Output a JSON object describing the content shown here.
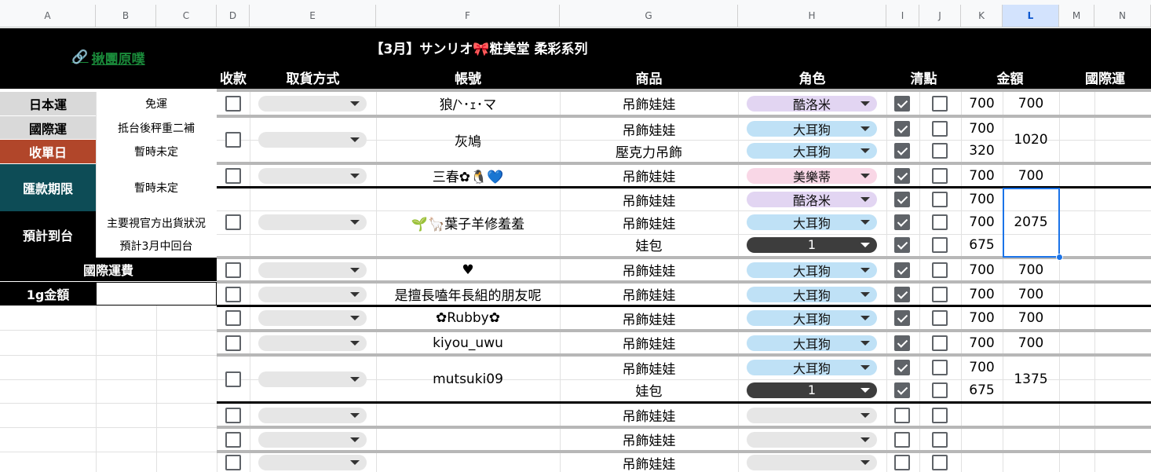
{
  "column_headers": [
    "A",
    "B",
    "C",
    "D",
    "E",
    "F",
    "G",
    "H",
    "I",
    "J",
    "K",
    "L",
    "M",
    "N"
  ],
  "selected_column": "L",
  "title": "【3月】サンリオ🎀粧美堂 柔彩系列",
  "link_text": "揪團原噗",
  "headers": {
    "col_payment": "收款",
    "col_pickup": "取貨方式",
    "col_account": "帳號",
    "col_product": "商品",
    "col_character": "角色",
    "col_check": "清點",
    "col_amount": "金額",
    "col_intl": "國際運"
  },
  "sidebar": {
    "jp_ship_label": "日本運",
    "jp_ship_value": "免運",
    "intl_ship_label": "國際運",
    "intl_ship_value": "抵台後秤重二補",
    "close_date_label": "收單日",
    "close_date_value": "暫時未定",
    "deadline_label": "匯款期限",
    "deadline_value": "暫時未定",
    "arrival_label": "預計到台",
    "arrival_value1": "主要視官方出貨狀況",
    "arrival_value2": "預計3月中回台",
    "intl_fee_label": "國際運費",
    "gram_label": "1g金額"
  },
  "colors": {
    "purple_chip": "#e2d5f2",
    "blue_chip": "#bfe1f6",
    "pink_chip": "#f9d7e6",
    "dark_chip": "#3d3d3d",
    "empty_chip": "#e6e6e6",
    "close_date_bg": "#b1462a",
    "deadline_bg": "#0d4c56",
    "label_bg": "#d9d9d9",
    "link_color": "#1a8a3a"
  },
  "rows": {
    "r1": {
      "account": "狼/ᐠ･ｪ･マ",
      "product": "吊飾娃娃",
      "character": "酷洛米",
      "k": "700",
      "l": "700"
    },
    "r2": {
      "account": "灰鳩",
      "l": "1020",
      "items": [
        {
          "product": "吊飾娃娃",
          "character": "大耳狗",
          "k": "700"
        },
        {
          "product": "壓克力吊飾",
          "character": "大耳狗",
          "k": "320"
        }
      ]
    },
    "r3": {
      "account": "三春✿🐧💙",
      "product": "吊飾娃娃",
      "character": "美樂蒂",
      "k": "700",
      "l": "700"
    },
    "r4": {
      "account": "🌱🦙葉子羊修羞羞",
      "l": "2075",
      "items": [
        {
          "product": "吊飾娃娃",
          "character": "酷洛米",
          "k": "700"
        },
        {
          "product": "吊飾娃娃",
          "character": "大耳狗",
          "k": "700"
        },
        {
          "product": "娃包",
          "character": "1",
          "k": "675"
        }
      ]
    },
    "r5": {
      "account": "♥",
      "product": "吊飾娃娃",
      "character": "大耳狗",
      "k": "700",
      "l": "700"
    },
    "r6": {
      "account": "是擅長嗑年長組的朋友呢",
      "product": "吊飾娃娃",
      "character": "大耳狗",
      "k": "700",
      "l": "700"
    },
    "r7": {
      "account": "✿Rubby✿",
      "product": "吊飾娃娃",
      "character": "大耳狗",
      "k": "700",
      "l": "700"
    },
    "r8": {
      "account": "kiyou_uwu",
      "product": "吊飾娃娃",
      "character": "大耳狗",
      "k": "700",
      "l": "700"
    },
    "r9": {
      "account": "mutsuki09",
      "l": "1375",
      "items": [
        {
          "product": "吊飾娃娃",
          "character": "大耳狗",
          "k": "700"
        },
        {
          "product": "娃包",
          "character": "1",
          "k": "675"
        }
      ]
    },
    "empty_product": "吊飾娃娃"
  }
}
